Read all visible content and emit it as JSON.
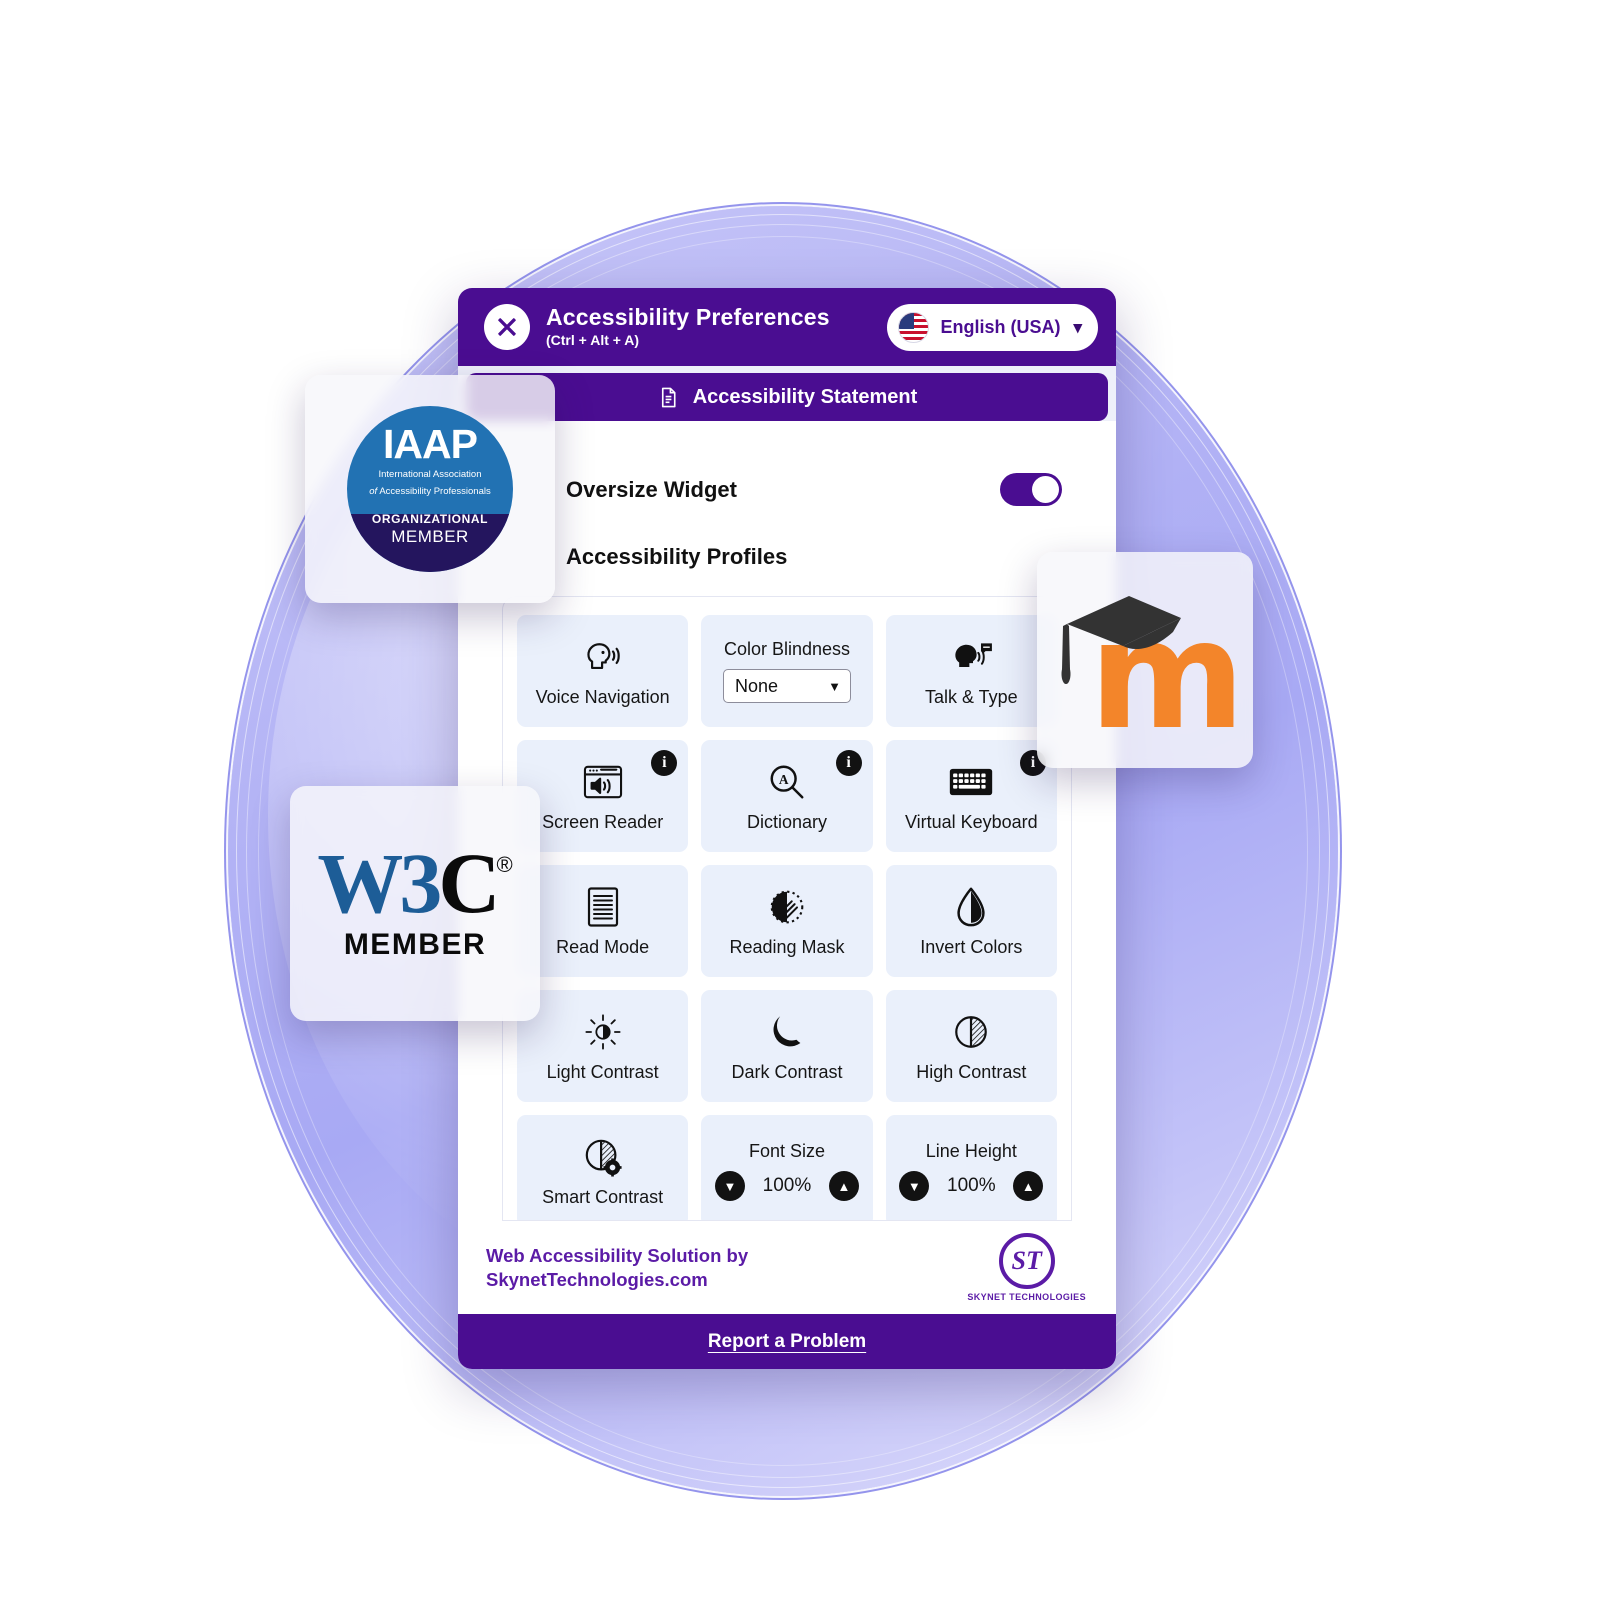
{
  "colors": {
    "brand_purple": "#4a0d91",
    "footer_purple": "#5b1ba6",
    "tile_bg": "#eaf0fb",
    "blob_violet": "#b3b3f5"
  },
  "header": {
    "close_icon": "close-x-icon",
    "title": "Accessibility Preferences",
    "shortcut": "(Ctrl + Alt + A)",
    "language": {
      "flag_icon": "us-flag-icon",
      "label": "English (USA)",
      "chevron": "⌄"
    }
  },
  "statement_bar": {
    "icon": "document-icon",
    "label": "Accessibility Statement"
  },
  "settings": {
    "oversize_widget_label": "Oversize Widget",
    "oversize_widget_on": true,
    "profiles_label": "Accessibility Profiles"
  },
  "features": [
    {
      "id": "voice-navigation",
      "type": "icon",
      "icon": "speaking-head-icon",
      "label": "Voice Navigation",
      "info": false
    },
    {
      "id": "color-blindness",
      "type": "select",
      "label": "Color Blindness",
      "value": "None",
      "options": [
        "None"
      ],
      "info": false
    },
    {
      "id": "talk-and-type",
      "type": "icon",
      "icon": "talk-type-icon",
      "label": "Talk & Type",
      "info": false
    },
    {
      "id": "screen-reader",
      "type": "icon",
      "icon": "screen-reader-icon",
      "label": "Screen Reader",
      "info": true
    },
    {
      "id": "dictionary",
      "type": "icon",
      "icon": "dictionary-search-icon",
      "label": "Dictionary",
      "info": true
    },
    {
      "id": "virtual-keyboard",
      "type": "icon",
      "icon": "keyboard-icon",
      "label": "Virtual Keyboard",
      "info": true
    },
    {
      "id": "read-mode",
      "type": "icon",
      "icon": "document-lines-icon",
      "label": "Read Mode",
      "info": false
    },
    {
      "id": "reading-mask",
      "type": "icon",
      "icon": "reading-mask-icon",
      "label": "Reading Mask",
      "info": false
    },
    {
      "id": "invert-colors",
      "type": "icon",
      "icon": "droplet-contrast-icon",
      "label": "Invert Colors",
      "info": false
    },
    {
      "id": "light-contrast",
      "type": "icon",
      "icon": "sun-contrast-icon",
      "label": "Light Contrast",
      "info": false
    },
    {
      "id": "dark-contrast",
      "type": "icon",
      "icon": "moon-icon",
      "label": "Dark Contrast",
      "info": false
    },
    {
      "id": "high-contrast",
      "type": "icon",
      "icon": "circle-contrast-icon",
      "label": "High Contrast",
      "info": false
    },
    {
      "id": "smart-contrast",
      "type": "icon",
      "icon": "circle-gear-contrast-icon",
      "label": "Smart Contrast",
      "info": false
    },
    {
      "id": "font-size",
      "type": "stepper",
      "label": "Font Size",
      "value": "100%",
      "decrease_icon": "chevron-down-icon",
      "increase_icon": "chevron-up-icon"
    },
    {
      "id": "line-height",
      "type": "stepper",
      "label": "Line Height",
      "value": "100%",
      "decrease_icon": "chevron-down-icon",
      "increase_icon": "chevron-up-icon"
    }
  ],
  "footer": {
    "line1": "Web Accessibility Solution by",
    "line2": "SkynetTechnologies.com",
    "logo_mark": "ST",
    "logo_name": "SKYNET TECHNOLOGIES",
    "report_label": "Report a Problem"
  },
  "badges": {
    "iaap": {
      "acronym": "IAAP",
      "line1": "International Association",
      "line2_italic": "of",
      "line2": "Accessibility Professionals",
      "tier": "ORGANIZATIONAL",
      "member": "MEMBER"
    },
    "w3c": {
      "logo_blue": "W3",
      "logo_black": "C",
      "registered": "®",
      "member": "MEMBER"
    },
    "moodle": {
      "letter": "m",
      "cap_icon": "graduation-cap-icon"
    }
  }
}
